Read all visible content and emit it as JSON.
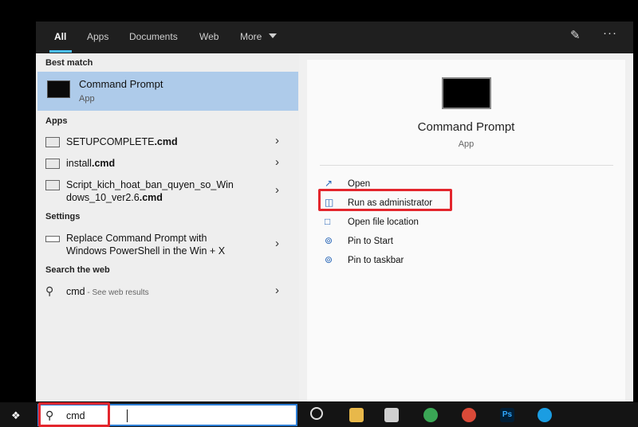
{
  "tabs": [
    {
      "label": "All"
    },
    {
      "label": "Apps"
    },
    {
      "label": "Documents"
    },
    {
      "label": "Web"
    },
    {
      "label": "More"
    }
  ],
  "sections": {
    "best_match": "Best match",
    "apps": "Apps",
    "settings": "Settings",
    "search_web": "Search the web"
  },
  "best_match": {
    "title": "Command Prompt",
    "subtitle": "App"
  },
  "apps": [
    {
      "name": "SETUPCOMPLETE",
      "ext": ".cmd"
    },
    {
      "name": "install",
      "ext": ".cmd"
    },
    {
      "line1": "Script_kich_hoat_ban_quyen_so_Win",
      "line2": "dows_10_ver2.6",
      "ext": ".cmd"
    }
  ],
  "settings_item": {
    "line1": "Replace Command Prompt with",
    "line2": "Windows PowerShell in the Win + X"
  },
  "web_item": {
    "query": "cmd",
    "note": " - See web results"
  },
  "detail": {
    "title": "Command Prompt",
    "type": "App"
  },
  "actions": [
    {
      "label": "Open",
      "icon": "open-icon"
    },
    {
      "label": "Run as administrator",
      "icon": "shield-icon"
    },
    {
      "label": "Open file location",
      "icon": "folder-icon"
    },
    {
      "label": "Pin to Start",
      "icon": "pin-icon"
    },
    {
      "label": "Pin to taskbar",
      "icon": "pin-icon"
    }
  ],
  "taskbar": {
    "search_value": "cmd",
    "ps_label": "Ps"
  },
  "colors": {
    "accent": "#4cc2ff",
    "selected": "#aecbea",
    "highlight": "#e3262d"
  }
}
